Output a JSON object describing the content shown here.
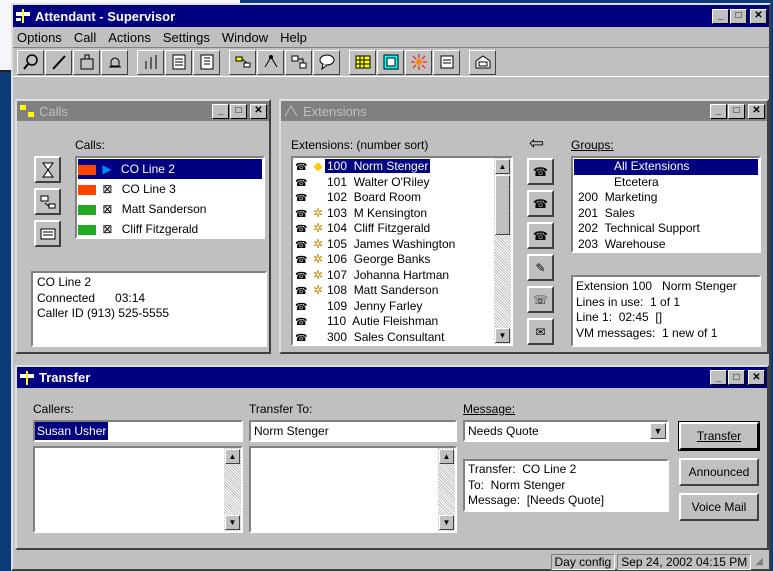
{
  "app": {
    "title": "Attendant - Supervisor"
  },
  "menu": [
    "Options",
    "Call",
    "Actions",
    "Settings",
    "Window",
    "Help"
  ],
  "toolbar_icons": [
    "search-icon",
    "pen-icon",
    "building-icon",
    "bell-icon",
    "signal-icon",
    "page-icon",
    "grid-page-icon",
    "route-icon",
    "network-icon",
    "forward-icon",
    "chat-icon",
    "keypad-icon",
    "directory-icon",
    "sun-icon",
    "phone-book-icon",
    "mail-icon"
  ],
  "calls": {
    "title": "Calls",
    "label": "Calls:",
    "items": [
      {
        "name": "CO Line 2",
        "selected": true
      },
      {
        "name": "CO Line 3",
        "selected": false
      },
      {
        "name": "Matt Sanderson",
        "selected": false
      },
      {
        "name": "Cliff Fitzgerald",
        "selected": false
      }
    ],
    "info": [
      "CO Line 2",
      "Connected      03:14",
      "Caller ID  (913) 525-5555"
    ]
  },
  "extensions": {
    "title": "Extensions",
    "label": "Extensions: (number sort)",
    "items": [
      {
        "mark": "◆",
        "text": "100  Norm Stenger",
        "selected": true
      },
      {
        "mark": "",
        "text": "101  Walter O'Riley",
        "selected": false
      },
      {
        "mark": "",
        "text": "102  Board Room",
        "selected": false
      },
      {
        "mark": "✲",
        "text": "103  M Kensington",
        "selected": false
      },
      {
        "mark": "✲",
        "text": "104  Cliff Fitzgerald",
        "selected": false
      },
      {
        "mark": "✲",
        "text": "105  James Washington",
        "selected": false
      },
      {
        "mark": "✲",
        "text": "106  George Banks",
        "selected": false
      },
      {
        "mark": "✲",
        "text": "107  Johanna Hartman",
        "selected": false
      },
      {
        "mark": "✲",
        "text": "108  Matt Sanderson",
        "selected": false
      },
      {
        "mark": "",
        "text": "109  Jenny Farley",
        "selected": false
      },
      {
        "mark": "",
        "text": "110  Autie Fleishman",
        "selected": false
      },
      {
        "mark": "",
        "text": "300  Sales Consultant",
        "selected": false
      }
    ],
    "arrow": "⇦",
    "groups_label": "Groups:",
    "groups": [
      {
        "text": "All Extensions",
        "selected": true
      },
      {
        "text": "Etcetera",
        "selected": false
      },
      {
        "text": "200  Marketing",
        "selected": false
      },
      {
        "text": "201  Sales",
        "selected": false
      },
      {
        "text": "202  Technical Support",
        "selected": false
      },
      {
        "text": "203  Warehouse",
        "selected": false
      }
    ],
    "info": [
      "Extension 100   Norm Stenger",
      "Lines in use:  1 of 1",
      "Line 1:  02:45  []",
      "VM messages:  1 new of 1"
    ]
  },
  "transfer": {
    "title": "Transfer",
    "callers_label": "Callers:",
    "callers_value": "Susan Usher",
    "to_label": "Transfer To:",
    "to_value": "Norm Stenger",
    "message_label": "Message:",
    "message_value": "Needs Quote",
    "summary": [
      "Transfer:  CO Line 2",
      "To:  Norm Stenger",
      "Message:  [Needs Quote]"
    ],
    "btn_transfer": "Transfer",
    "btn_announced": "Announced",
    "btn_voicemail": "Voice Mail"
  },
  "status": {
    "config": "Day config",
    "datetime": "Sep 24, 2002 04:15 PM"
  }
}
